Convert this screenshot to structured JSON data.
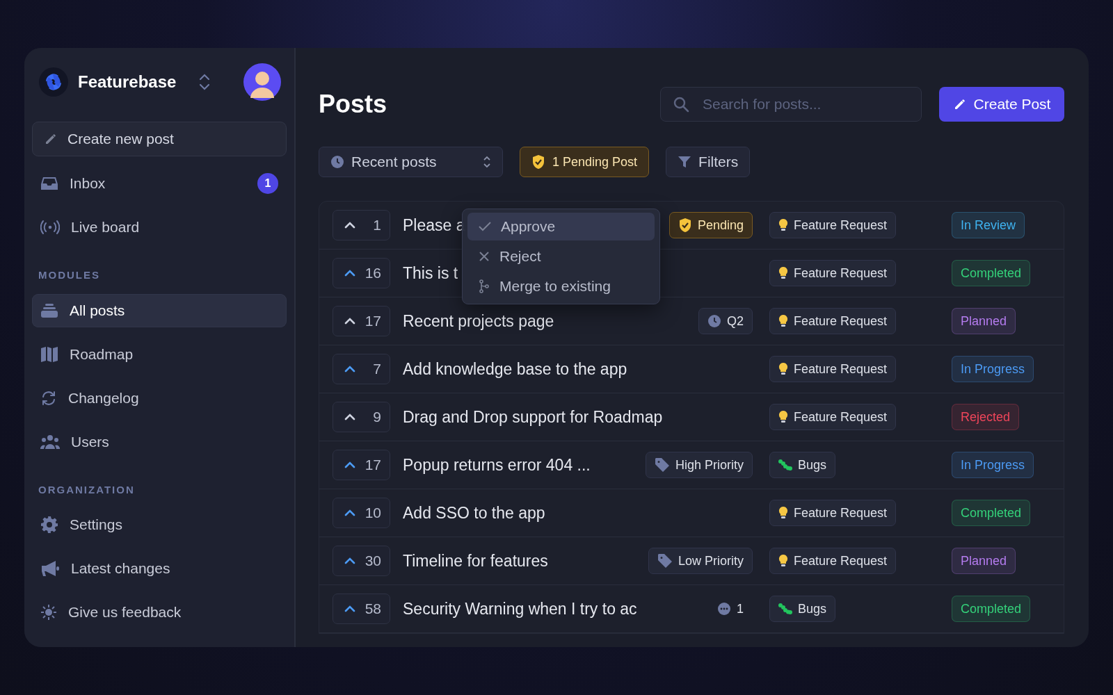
{
  "brand": {
    "name": "Featurebase"
  },
  "sidebar": {
    "create_button": "Create new post",
    "groups": [
      {
        "items": [
          {
            "label": "Inbox",
            "badge": "1",
            "selected": false
          },
          {
            "label": "Live board",
            "selected": false
          }
        ]
      },
      {
        "title": "MODULES",
        "items": [
          {
            "label": "All posts",
            "selected": true
          },
          {
            "label": "Roadmap",
            "selected": false
          },
          {
            "label": "Changelog",
            "selected": false
          },
          {
            "label": "Users",
            "selected": false
          }
        ]
      },
      {
        "title": "ORGANIZATION",
        "items": [
          {
            "label": "Settings",
            "selected": false
          },
          {
            "label": "Latest changes",
            "selected": false
          },
          {
            "label": "Give us feedback",
            "selected": false
          }
        ]
      }
    ]
  },
  "header": {
    "title": "Posts",
    "search": {
      "placeholder": "Search for posts..."
    },
    "create_button": "Create Post"
  },
  "toolbar": {
    "sort": "Recent posts",
    "pending": "1 Pending Post",
    "filters": "Filters"
  },
  "posts": [
    {
      "votes": "1",
      "voted": false,
      "title": "Please a",
      "tag": {
        "kind": "pending",
        "label": "Pending"
      },
      "category": {
        "kind": "feature",
        "label": "Feature Request"
      },
      "status": {
        "label": "In Review",
        "color": "#3fb3f0"
      }
    },
    {
      "votes": "16",
      "voted": true,
      "title": "This is t",
      "category": {
        "kind": "feature",
        "label": "Feature Request"
      },
      "status": {
        "label": "Completed",
        "color": "#34d27a"
      }
    },
    {
      "votes": "17",
      "voted": false,
      "title": "Recent projects page",
      "tag": {
        "kind": "roadmap",
        "label": "Q2"
      },
      "category": {
        "kind": "feature",
        "label": "Feature Request"
      },
      "status": {
        "label": "Planned",
        "color": "#b57cf0"
      }
    },
    {
      "votes": "7",
      "voted": true,
      "title": "Add knowledge base to the app",
      "category": {
        "kind": "feature",
        "label": "Feature Request"
      },
      "status": {
        "label": "In Progress",
        "color": "#4c9bf5"
      }
    },
    {
      "votes": "9",
      "voted": false,
      "title": "Drag and Drop support for Roadmap",
      "category": {
        "kind": "feature",
        "label": "Feature Request"
      },
      "status": {
        "label": "Rejected",
        "color": "#f0455a"
      }
    },
    {
      "votes": "17",
      "voted": true,
      "title": "Popup returns error 404 ...",
      "tag": {
        "kind": "priority",
        "label": "High Priority"
      },
      "category": {
        "kind": "bug",
        "label": "Bugs"
      },
      "status": {
        "label": "In Progress",
        "color": "#4c9bf5"
      }
    },
    {
      "votes": "10",
      "voted": true,
      "title": "Add SSO to the app",
      "category": {
        "kind": "feature",
        "label": "Feature Request"
      },
      "status": {
        "label": "Completed",
        "color": "#34d27a"
      }
    },
    {
      "votes": "30",
      "voted": true,
      "title": "Timeline for features",
      "tag": {
        "kind": "priority",
        "label": "Low Priority"
      },
      "category": {
        "kind": "feature",
        "label": "Feature Request"
      },
      "status": {
        "label": "Planned",
        "color": "#b57cf0"
      }
    },
    {
      "votes": "58",
      "voted": true,
      "title": "Security Warning when I try to ac",
      "tag": {
        "kind": "comments",
        "label": "1"
      },
      "category": {
        "kind": "bug",
        "label": "Bugs"
      },
      "status": {
        "label": "Completed",
        "color": "#34d27a"
      }
    }
  ],
  "menu": {
    "items": [
      {
        "label": "Approve",
        "selected": true
      },
      {
        "label": "Reject",
        "selected": false
      },
      {
        "label": "Merge to existing",
        "selected": false
      }
    ]
  }
}
